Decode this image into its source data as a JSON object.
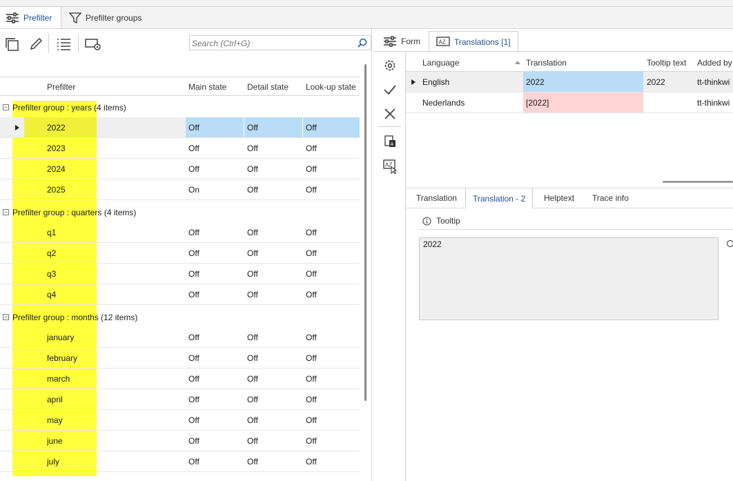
{
  "tabs": [
    {
      "label": "Prefilter",
      "icon": "sliders-icon",
      "active": true
    },
    {
      "label": "Prefilter groups",
      "icon": "funnel-icon",
      "active": false
    }
  ],
  "toolbar": {
    "search_placeholder": "Search (Ctrl+G)",
    "icons": [
      "copy-icon",
      "edit-pencil-icon",
      "ordered-list-icon",
      "screen-settings-icon"
    ]
  },
  "grid": {
    "columns": [
      "Prefilter",
      "Main state",
      "Detail state",
      "Look-up state"
    ],
    "groups": [
      {
        "label": "Prefilter group : years (4 items)",
        "rows": [
          {
            "name": "2022",
            "main": "Off",
            "detail": "Off",
            "lookup": "Off",
            "selected": true
          },
          {
            "name": "2023",
            "main": "Off",
            "detail": "Off",
            "lookup": "Off"
          },
          {
            "name": "2024",
            "main": "Off",
            "detail": "Off",
            "lookup": "Off"
          },
          {
            "name": "2025",
            "main": "On",
            "detail": "Off",
            "lookup": "Off"
          }
        ]
      },
      {
        "label": "Prefilter group : quarters (4 items)",
        "rows": [
          {
            "name": "q1",
            "main": "Off",
            "detail": "Off",
            "lookup": "Off"
          },
          {
            "name": "q2",
            "main": "Off",
            "detail": "Off",
            "lookup": "Off"
          },
          {
            "name": "q3",
            "main": "Off",
            "detail": "Off",
            "lookup": "Off"
          },
          {
            "name": "q4",
            "main": "Off",
            "detail": "Off",
            "lookup": "Off"
          }
        ]
      },
      {
        "label": "Prefilter group : months (12 items)",
        "rows": [
          {
            "name": "january",
            "main": "Off",
            "detail": "Off",
            "lookup": "Off"
          },
          {
            "name": "february",
            "main": "Off",
            "detail": "Off",
            "lookup": "Off"
          },
          {
            "name": "march",
            "main": "Off",
            "detail": "Off",
            "lookup": "Off"
          },
          {
            "name": "april",
            "main": "Off",
            "detail": "Off",
            "lookup": "Off"
          },
          {
            "name": "may",
            "main": "Off",
            "detail": "Off",
            "lookup": "Off"
          },
          {
            "name": "june",
            "main": "Off",
            "detail": "Off",
            "lookup": "Off"
          },
          {
            "name": "july",
            "main": "Off",
            "detail": "Off",
            "lookup": "Off"
          }
        ]
      }
    ]
  },
  "right_tabs": [
    {
      "label": "Form",
      "icon": "sliders-icon",
      "active": false
    },
    {
      "label": "Translations [1]",
      "icon": "translate-icon",
      "active": true
    }
  ],
  "translations": {
    "columns": [
      "Language",
      "Translation",
      "Tooltip text",
      "Added by"
    ],
    "rows": [
      {
        "language": "English",
        "translation": "2022",
        "tooltip": "2022",
        "added_by": "tt-thinkwi",
        "selected": true
      },
      {
        "language": "Nederlands",
        "translation": "[2022]",
        "tooltip": "",
        "added_by": "tt-thinkwi",
        "invalid": true
      }
    ]
  },
  "bottom_tabs": [
    "Translation",
    "Translation - 2",
    "Helptext",
    "Trace info"
  ],
  "bottom_active": "Translation - 2",
  "tooltip_panel": {
    "label": "Tooltip",
    "value": "2022"
  },
  "colors": {
    "highlight_yellow": "#ffff3b",
    "selection_blue": "#b9dcf7",
    "invalid_red": "#ffd4d4",
    "active_tab_text": "#1f4f8f"
  }
}
